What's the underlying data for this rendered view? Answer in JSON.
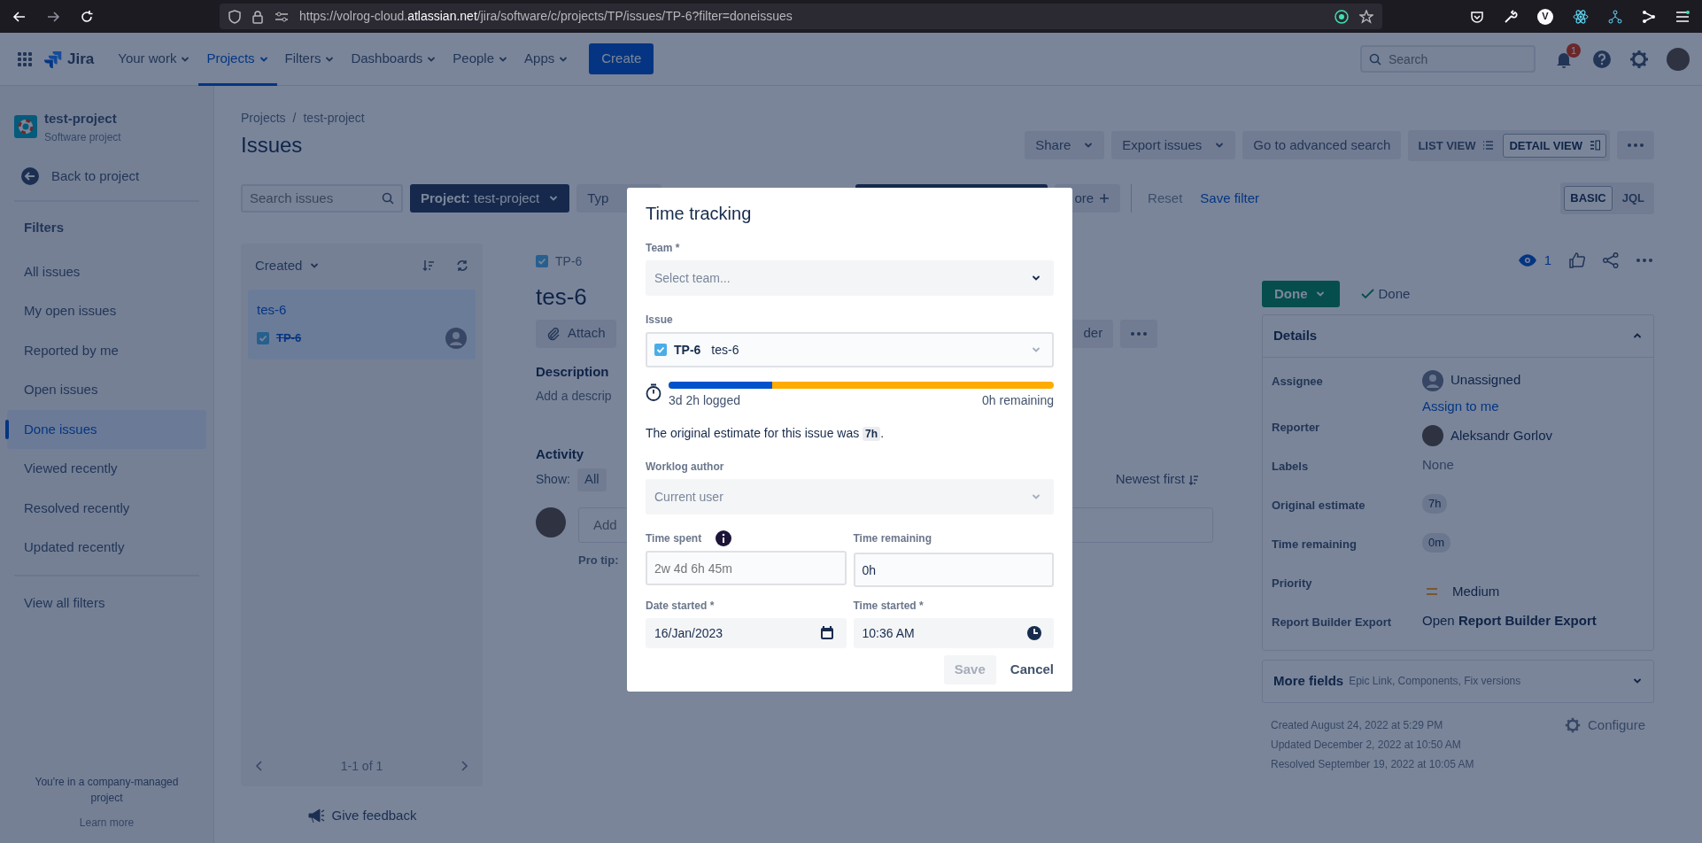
{
  "browser": {
    "url": {
      "prefix": "https://volrog-cloud.",
      "domain": "atlassian.net",
      "path": "/jira/software/c/projects/TP/issues/TP-6?filter=doneissues"
    },
    "extension_letter": "V"
  },
  "topnav": {
    "product": "Jira",
    "items": [
      {
        "label": "Your work",
        "selected": false
      },
      {
        "label": "Projects",
        "selected": true
      },
      {
        "label": "Filters",
        "selected": false
      },
      {
        "label": "Dashboards",
        "selected": false
      },
      {
        "label": "People",
        "selected": false
      },
      {
        "label": "Apps",
        "selected": false
      }
    ],
    "create": "Create",
    "search_placeholder": "Search",
    "notification_count": "1"
  },
  "sidebar": {
    "project_name": "test-project",
    "project_type": "Software project",
    "back": "Back to project",
    "heading": "Filters",
    "filters": [
      {
        "label": "All issues",
        "selected": false
      },
      {
        "label": "My open issues",
        "selected": false
      },
      {
        "label": "Reported by me",
        "selected": false
      },
      {
        "label": "Open issues",
        "selected": false
      },
      {
        "label": "Done issues",
        "selected": true
      },
      {
        "label": "Viewed recently",
        "selected": false
      },
      {
        "label": "Resolved recently",
        "selected": false
      },
      {
        "label": "Updated recently",
        "selected": false
      }
    ],
    "view_all": "View all filters",
    "footer_note": "You're in a company-managed project",
    "learn_more": "Learn more"
  },
  "header": {
    "breadcrumbs": [
      "Projects",
      "test-project"
    ],
    "breadcrumb_separator": "/",
    "title": "Issues",
    "actions": [
      "Share",
      "Export issues"
    ],
    "advanced_search": "Go to advanced search",
    "views": [
      {
        "label": "LIST VIEW",
        "selected": false
      },
      {
        "label": "DETAIL VIEW",
        "selected": true
      }
    ]
  },
  "filter_bar": {
    "search_placeholder": "Search issues",
    "project_label": "Project:",
    "project_value": "test-project",
    "type_partial": "Typ",
    "more_partial": "ore",
    "reset": "Reset",
    "save_filter": "Save filter",
    "modes": [
      {
        "label": "BASIC",
        "selected": true
      },
      {
        "label": "JQL",
        "selected": false
      }
    ]
  },
  "issue_list": {
    "sort": "Created",
    "issues": [
      {
        "summary": "tes-6",
        "key": "TP-6",
        "done": true,
        "selected": true
      }
    ],
    "pagination": "1-1 of 1",
    "feedback": "Give feedback"
  },
  "issue": {
    "key": "TP-6",
    "summary": "tes-6",
    "attach": "Attach",
    "action_partial": "der",
    "description_heading": "Description",
    "description_placeholder": "Add a descrip",
    "activity_heading": "Activity",
    "show_label": "Show:",
    "show_all": "All",
    "sort": "Newest first",
    "comment_placeholder": "Add",
    "pro_tip": "Pro tip:",
    "watchers": "1",
    "status": "Done",
    "resolution": "Done"
  },
  "details": {
    "title": "Details",
    "expanded": true,
    "fields": [
      {
        "label": "Assignee",
        "kind": "user",
        "value": "Unassigned",
        "link": "Assign to me"
      },
      {
        "label": "Reporter",
        "kind": "photo",
        "value": "Aleksandr Gorlov"
      },
      {
        "label": "Labels",
        "kind": "muted",
        "value": "None"
      },
      {
        "label": "Original estimate",
        "kind": "chip",
        "value": "7h"
      },
      {
        "label": "Time remaining",
        "kind": "chip",
        "value": "0m"
      },
      {
        "label": "Priority",
        "kind": "priority",
        "value": "Medium"
      },
      {
        "label": "Report Builder Export",
        "kind": "rich",
        "value": "Open **Report Builder Export**"
      }
    ]
  },
  "more_fields": {
    "title": "More fields",
    "summary": "Epic Link, Components, Fix versions",
    "expanded": false
  },
  "dates": [
    "Created August 24, 2022 at 5:29 PM",
    "Updated December 2, 2022 at 10:50 AM",
    "Resolved September 19, 2022 at 10:05 AM"
  ],
  "configure": "Configure",
  "modal": {
    "title": "Time tracking",
    "team": {
      "label": "Team *",
      "placeholder": "Select team..."
    },
    "issue": {
      "label": "Issue",
      "key": "TP-6",
      "summary": "tes-6"
    },
    "progress": {
      "level": 0.27,
      "logged": "3d 2h logged",
      "remaining": "0h remaining"
    },
    "estimate_note": {
      "before": "The original estimate for this issue was",
      "value": "7h",
      "after": "."
    },
    "author": {
      "label": "Worklog author",
      "placeholder": "Current user",
      "disabled": true
    },
    "time_spent": {
      "label": "Time spent",
      "placeholder": "2w 4d 6h 45m"
    },
    "time_remaining": {
      "label": "Time remaining",
      "value": "0h"
    },
    "date_started": {
      "label": "Date started *",
      "value": "16/Jan/2023"
    },
    "time_started": {
      "label": "Time started *",
      "value": "10:36 AM"
    },
    "buttons": [
      {
        "label": "Save",
        "disabled": true
      },
      {
        "label": "Cancel",
        "disabled": false
      }
    ]
  }
}
